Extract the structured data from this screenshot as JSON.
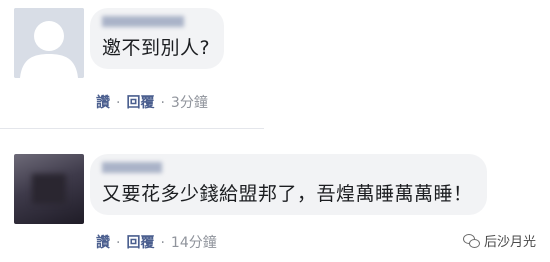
{
  "comments": [
    {
      "text": "邀不到別人?",
      "actions": {
        "like": "讚",
        "reply": "回覆",
        "time": "3分鐘"
      }
    },
    {
      "text": "又要花多少錢給盟邦了，吾煌萬睡萬萬睡！",
      "actions": {
        "like": "讚",
        "reply": "回覆",
        "time": "14分鐘"
      }
    }
  ],
  "separator": "·",
  "watermark": {
    "icon": "wechat-icon",
    "label": "后沙月光"
  }
}
